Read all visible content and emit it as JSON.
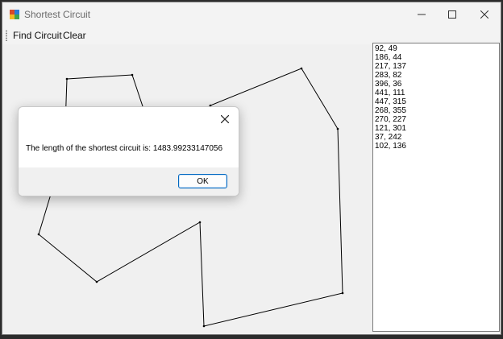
{
  "window": {
    "title": "Shortest Circuit"
  },
  "menu": {
    "items": [
      "Find Circuit",
      "Clear"
    ]
  },
  "points": [
    "92, 49",
    "186, 44",
    "217, 137",
    "283, 82",
    "396, 36",
    "441, 111",
    "447, 315",
    "268, 355",
    "270, 227",
    "121, 301",
    "37, 242",
    "102, 136"
  ],
  "dialog": {
    "message": "The length of the shortest circuit is: 1483.99233147056",
    "ok_label": "OK"
  },
  "colors": {
    "accent": "#0067c0",
    "line": "#000000"
  },
  "icons": {
    "app": "app-window-icon",
    "minimize": "minimize-icon",
    "maximize": "maximize-icon",
    "close": "close-icon",
    "dialog_close": "close-icon"
  }
}
